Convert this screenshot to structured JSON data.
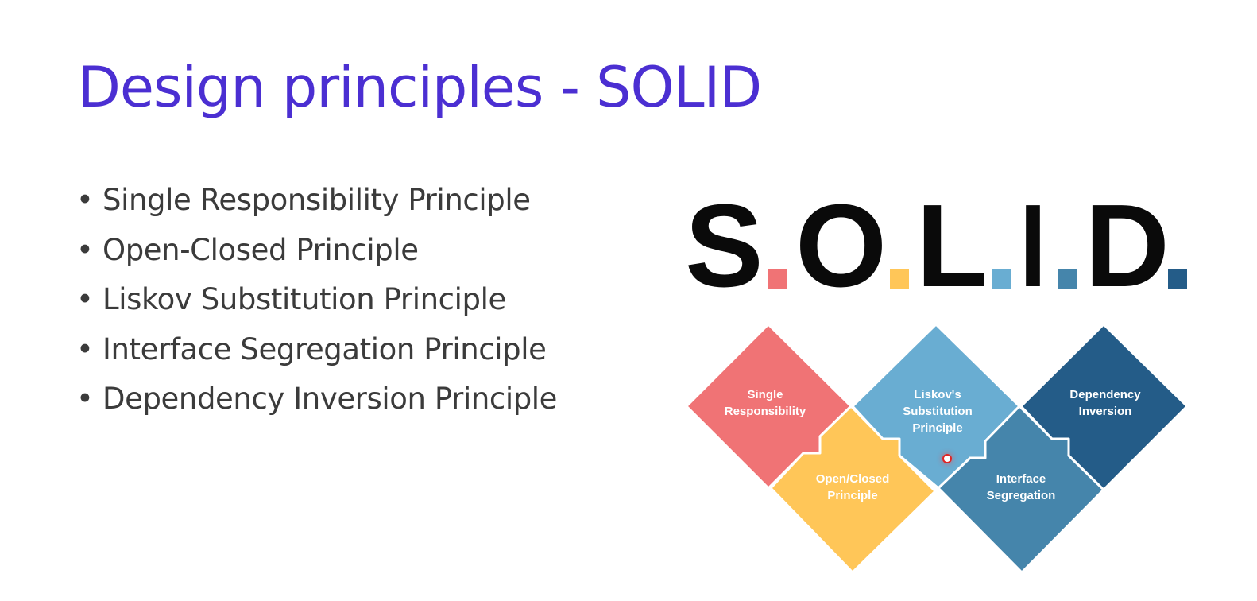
{
  "slide": {
    "title": "Design principles - SOLID",
    "title_color": "#4b2fd2",
    "bullet_symbol": "•",
    "bullets": [
      "Single Responsibility Principle",
      "Open-Closed Principle",
      "Liskov Substitution Principle",
      "Interface Segregation Principle",
      "Dependency Inversion Principle"
    ]
  },
  "logo": {
    "letters": [
      "S",
      "O",
      "L",
      "I",
      "D"
    ],
    "letter_color": "#0a0a0a",
    "dot_colors": [
      "#f07375",
      "#ffc658",
      "#69add2",
      "#4585ab",
      "#245c88"
    ]
  },
  "diagram": {
    "tiles": [
      {
        "name": "single-responsibility",
        "lines": [
          "Single",
          "Responsibility"
        ],
        "color": "#f07375"
      },
      {
        "name": "open-closed",
        "lines": [
          "Open/Closed",
          "Principle"
        ],
        "color": "#ffc658"
      },
      {
        "name": "liskov-substitution",
        "lines": [
          "Liskov's",
          "Substitution",
          "Principle"
        ],
        "color": "#69add2"
      },
      {
        "name": "interface-segregation",
        "lines": [
          "Interface",
          "Segregation"
        ],
        "color": "#4585ab"
      },
      {
        "name": "dependency-inversion",
        "lines": [
          "Dependency",
          "Inversion"
        ],
        "color": "#245c88"
      }
    ]
  }
}
